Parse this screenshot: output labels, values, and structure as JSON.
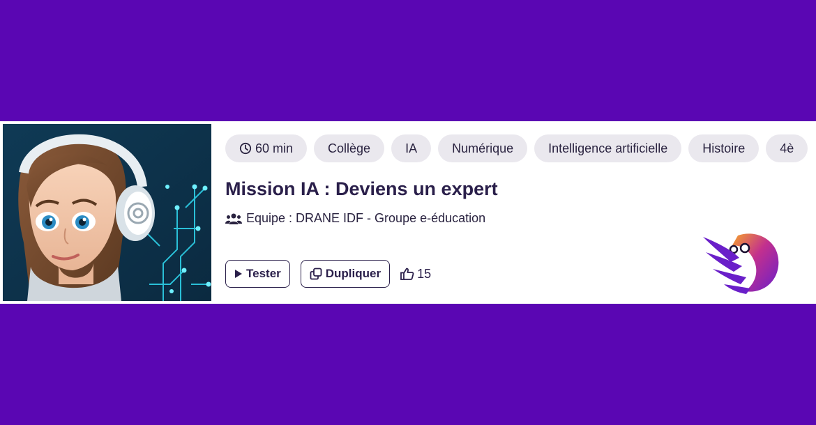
{
  "card": {
    "tags": [
      "60 min",
      "Collège",
      "IA",
      "Numérique",
      "Intelligence artificielle",
      "Histoire",
      "4è"
    ],
    "title": "Mission IA : Deviens un expert",
    "team": "Equipe : DRANE IDF - Groupe e-éducation",
    "buttons": {
      "test_label": "Tester",
      "duplicate_label": "Dupliquer"
    },
    "likes": "15"
  },
  "icons": {
    "duration": "clock-icon",
    "team": "users-icon",
    "test": "play-icon",
    "duplicate": "copy-icon",
    "likes": "thumbs-up-icon",
    "brand": "bird-logo"
  },
  "colors": {
    "background": "#5a06b3",
    "card": "#ffffff",
    "tag": "#eae8ee",
    "text": "#2a1f4a",
    "logo_purple": "#6a1fc9",
    "logo_orange": "#f39a2b"
  }
}
